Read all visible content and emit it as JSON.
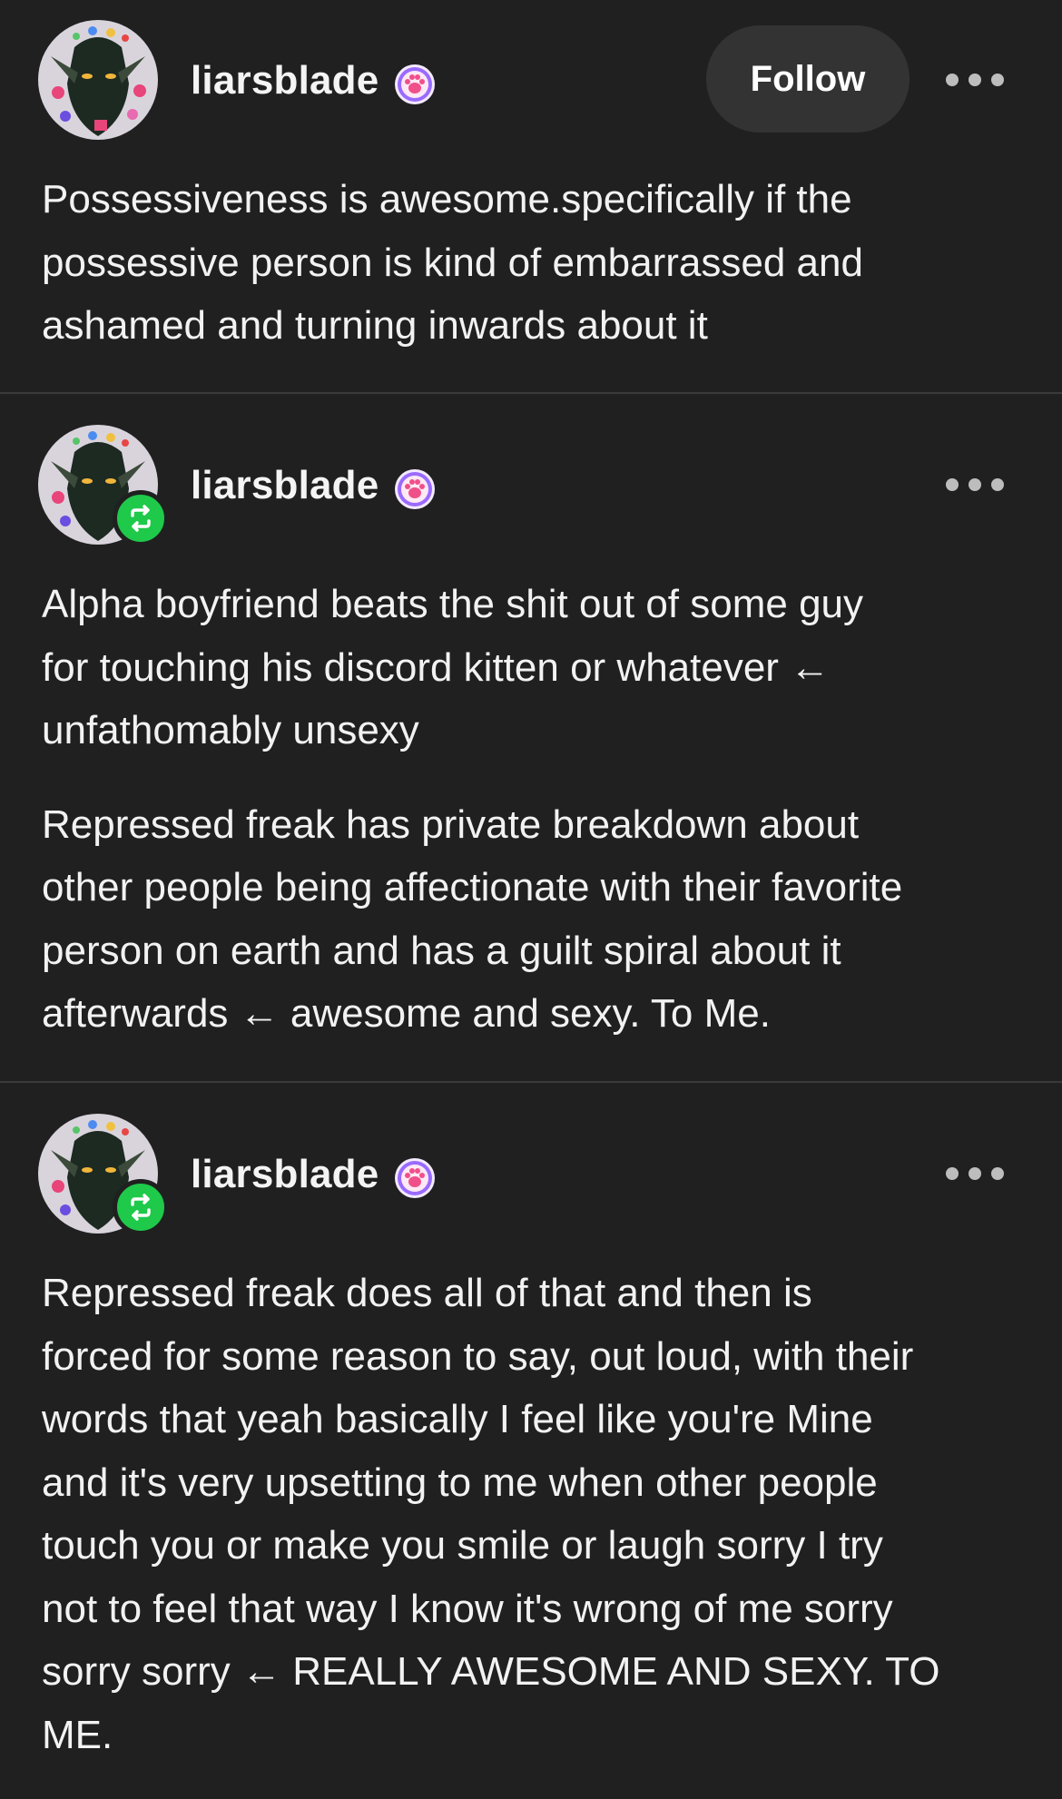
{
  "posts": [
    {
      "username": "liarsblade",
      "follow_label": "Follow",
      "is_reblog": false,
      "paragraphs": [
        "Possessiveness is awesome.specifically if the\npossessive person is kind of embarrassed and\nashamed and turning inwards about it"
      ]
    },
    {
      "username": "liarsblade",
      "is_reblog": true,
      "paragraphs": [
        "Alpha boyfriend beats the shit out of some guy\nfor touching his discord kitten or whatever ←\nunfathomably unsexy",
        "Repressed freak has private breakdown about\nother people being affectionate with their favorite\nperson on earth and has a guilt spiral about it\nafterwards ← awesome and sexy. To Me."
      ]
    },
    {
      "username": "liarsblade",
      "is_reblog": true,
      "paragraphs": [
        "Repressed freak does all of that and then is\nforced for some reason to say, out loud, with their\nwords that yeah basically I feel like you're Mine\nand it's very upsetting to me when other people\ntouch you or make you smile or laugh sorry I try\nnot to feel that way I know it's wrong of me sorry\nsorry sorry ← REALLY AWESOME AND SEXY. TO\nME."
      ]
    }
  ],
  "icons": {
    "more": "more-options-icon",
    "reblog": "reblog-icon",
    "badge": "paw-badge-icon"
  },
  "colors": {
    "background": "#202020",
    "text": "#f2f2f2",
    "follow_button": "#333333",
    "reblog_green": "#1fc94a",
    "badge_purple": "#9a6bff"
  }
}
